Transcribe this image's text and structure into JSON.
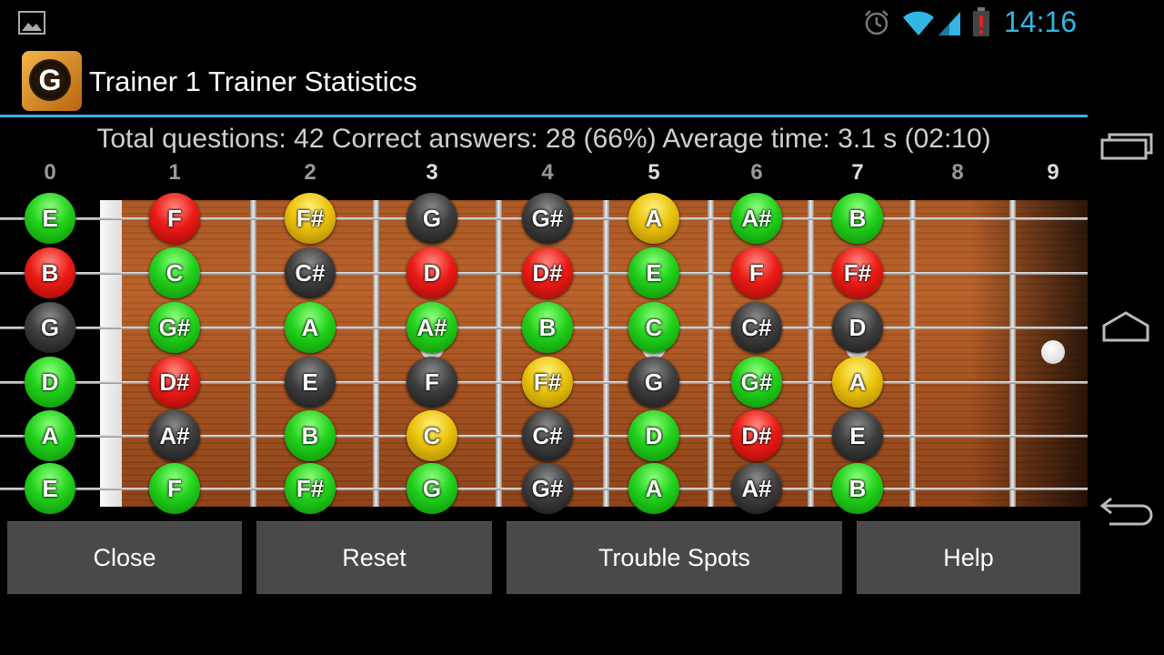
{
  "status_bar": {
    "time": "14:16",
    "icons": [
      "gallery-icon",
      "alarm-icon",
      "wifi-icon",
      "signal-icon",
      "battery-alert-icon"
    ],
    "accent_color": "#33b5e5"
  },
  "action_bar": {
    "app_icon_letter": "G",
    "title": "Trainer 1 Trainer Statistics"
  },
  "stats": {
    "text": "Total questions: 42 Correct answers: 28 (66%) Average time: 3.1 s (02:10)"
  },
  "fretboard": {
    "fret_numbers": [
      "0",
      "1",
      "2",
      "3",
      "4",
      "5",
      "6",
      "7",
      "8",
      "9"
    ],
    "color_legend": {
      "green": "#22d11c",
      "red": "#ec1b16",
      "yellow": "#eac20c",
      "dark": "#3e3e3e"
    },
    "strings": [
      {
        "notes": [
          {
            "n": "E",
            "c": "green"
          },
          {
            "n": "F",
            "c": "red"
          },
          {
            "n": "F#",
            "c": "yellow"
          },
          {
            "n": "G",
            "c": "dark"
          },
          {
            "n": "G#",
            "c": "dark"
          },
          {
            "n": "A",
            "c": "yellow"
          },
          {
            "n": "A#",
            "c": "green"
          },
          {
            "n": "B",
            "c": "green"
          }
        ]
      },
      {
        "notes": [
          {
            "n": "B",
            "c": "red"
          },
          {
            "n": "C",
            "c": "green"
          },
          {
            "n": "C#",
            "c": "dark"
          },
          {
            "n": "D",
            "c": "red"
          },
          {
            "n": "D#",
            "c": "red"
          },
          {
            "n": "E",
            "c": "green"
          },
          {
            "n": "F",
            "c": "red"
          },
          {
            "n": "F#",
            "c": "red"
          }
        ]
      },
      {
        "notes": [
          {
            "n": "G",
            "c": "dark"
          },
          {
            "n": "G#",
            "c": "green"
          },
          {
            "n": "A",
            "c": "green"
          },
          {
            "n": "A#",
            "c": "green"
          },
          {
            "n": "B",
            "c": "green"
          },
          {
            "n": "C",
            "c": "green"
          },
          {
            "n": "C#",
            "c": "dark"
          },
          {
            "n": "D",
            "c": "dark"
          }
        ]
      },
      {
        "notes": [
          {
            "n": "D",
            "c": "green"
          },
          {
            "n": "D#",
            "c": "red"
          },
          {
            "n": "E",
            "c": "dark"
          },
          {
            "n": "F",
            "c": "dark"
          },
          {
            "n": "F#",
            "c": "yellow"
          },
          {
            "n": "G",
            "c": "dark"
          },
          {
            "n": "G#",
            "c": "green"
          },
          {
            "n": "A",
            "c": "yellow"
          }
        ]
      },
      {
        "notes": [
          {
            "n": "A",
            "c": "green"
          },
          {
            "n": "A#",
            "c": "dark"
          },
          {
            "n": "B",
            "c": "green"
          },
          {
            "n": "C",
            "c": "yellow"
          },
          {
            "n": "C#",
            "c": "dark"
          },
          {
            "n": "D",
            "c": "green"
          },
          {
            "n": "D#",
            "c": "red"
          },
          {
            "n": "E",
            "c": "dark"
          }
        ]
      },
      {
        "notes": [
          {
            "n": "E",
            "c": "green"
          },
          {
            "n": "F",
            "c": "green"
          },
          {
            "n": "F#",
            "c": "green"
          },
          {
            "n": "G",
            "c": "green"
          },
          {
            "n": "G#",
            "c": "dark"
          },
          {
            "n": "A",
            "c": "green"
          },
          {
            "n": "A#",
            "c": "dark"
          },
          {
            "n": "B",
            "c": "green"
          }
        ]
      }
    ]
  },
  "buttons": {
    "close": "Close",
    "reset": "Reset",
    "trouble": "Trouble Spots",
    "help": "Help"
  },
  "nav": {
    "icons": [
      "recent-apps-icon",
      "home-icon",
      "back-icon"
    ]
  }
}
